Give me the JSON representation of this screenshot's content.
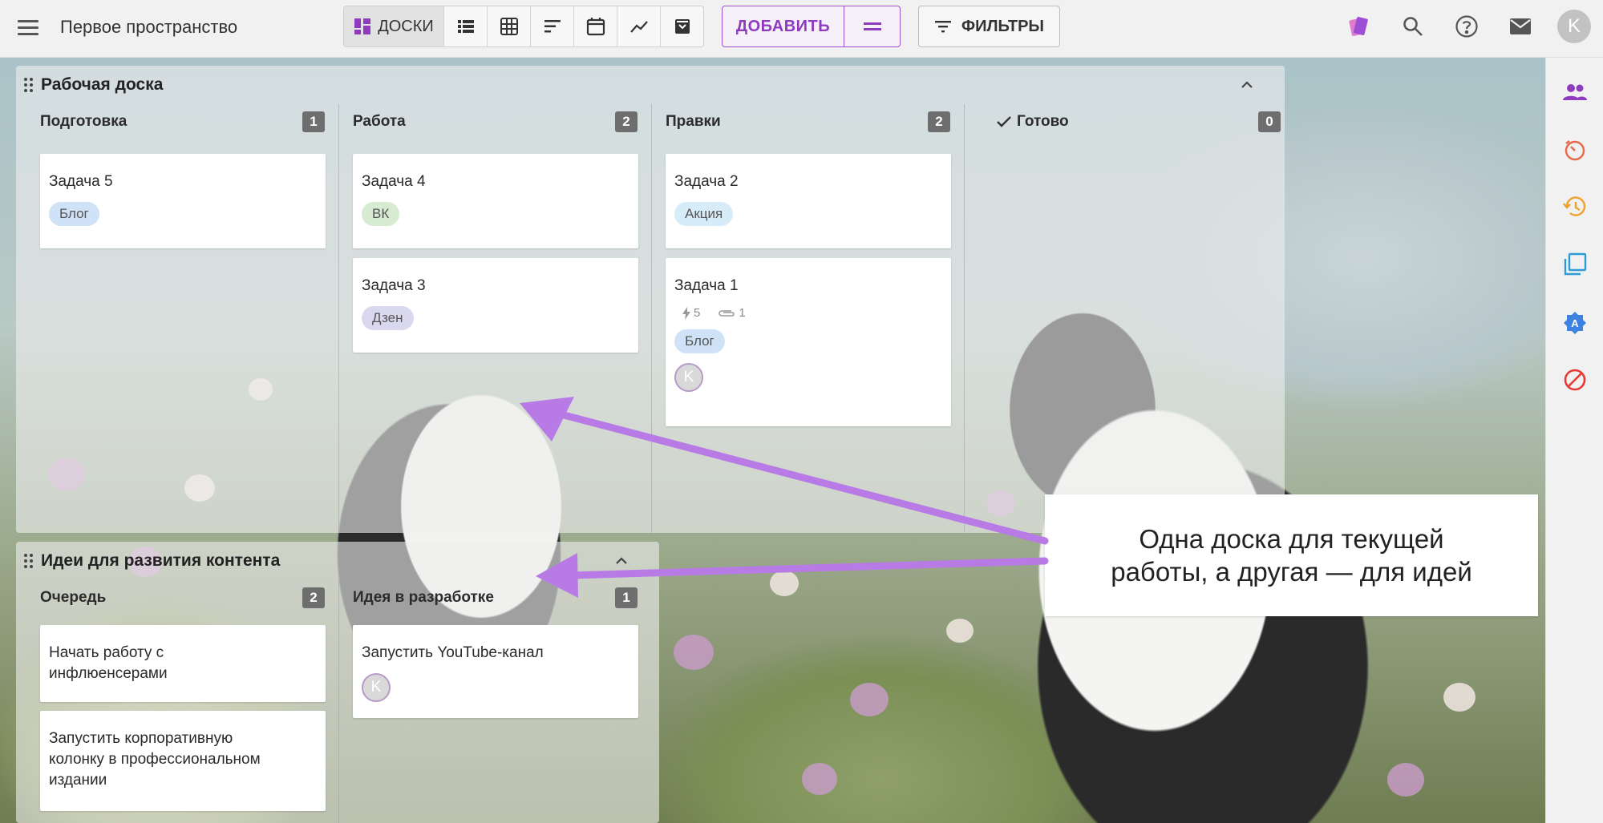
{
  "header": {
    "space_title": "Первое пространство",
    "views": [
      {
        "name": "boards",
        "label": "ДОСКИ",
        "icon": "boards-icon",
        "active": true
      },
      {
        "name": "list",
        "icon": "list-icon"
      },
      {
        "name": "table",
        "icon": "table-icon"
      },
      {
        "name": "gantt",
        "icon": "gantt-icon"
      },
      {
        "name": "calendar",
        "icon": "calendar-icon"
      },
      {
        "name": "chart",
        "icon": "chart-icon"
      },
      {
        "name": "archive",
        "icon": "archive-icon"
      }
    ],
    "add_label": "ДОБАВИТЬ",
    "filters_label": "ФИЛЬТРЫ",
    "user_initial": "K",
    "accent_color": "#8e3bbf"
  },
  "board1": {
    "title": "Рабочая доска",
    "columns": [
      {
        "title": "Подготовка",
        "count": "1",
        "cards": [
          {
            "title": "Задача 5",
            "tag": "Блог"
          }
        ]
      },
      {
        "title": "Работа",
        "count": "2",
        "cards": [
          {
            "title": "Задача 4",
            "tag": "ВК"
          },
          {
            "title": "Задача 3",
            "tag": "Дзен"
          }
        ]
      },
      {
        "title": "Правки",
        "count": "2",
        "cards": [
          {
            "title": "Задача 2",
            "tag": "Акция"
          },
          {
            "title": "Задача 1",
            "subtasks": "5",
            "attachments": "1",
            "tag": "Блог",
            "assignee": "K"
          }
        ]
      },
      {
        "title": "Готово",
        "count": "0",
        "cards": []
      }
    ]
  },
  "board2": {
    "title": "Идеи для развития контента",
    "columns": [
      {
        "title": "Очередь",
        "count": "2",
        "cards": [
          {
            "title": "Начать работу с инфлюенсерами"
          },
          {
            "title": "Запустить корпоративную колонку в профессиональном издании"
          }
        ]
      },
      {
        "title": "Идея в разработке",
        "count": "1",
        "cards": [
          {
            "title": "Запустить YouTube-канал",
            "assignee": "K"
          }
        ]
      }
    ]
  },
  "callout": {
    "line1": "Одна доска для текущей",
    "line2": "работы, а другая — для идей"
  },
  "sidebar_icons": [
    "people-icon",
    "timer-icon",
    "history-icon",
    "copy-icon",
    "badge-icon",
    "blocked-icon"
  ]
}
